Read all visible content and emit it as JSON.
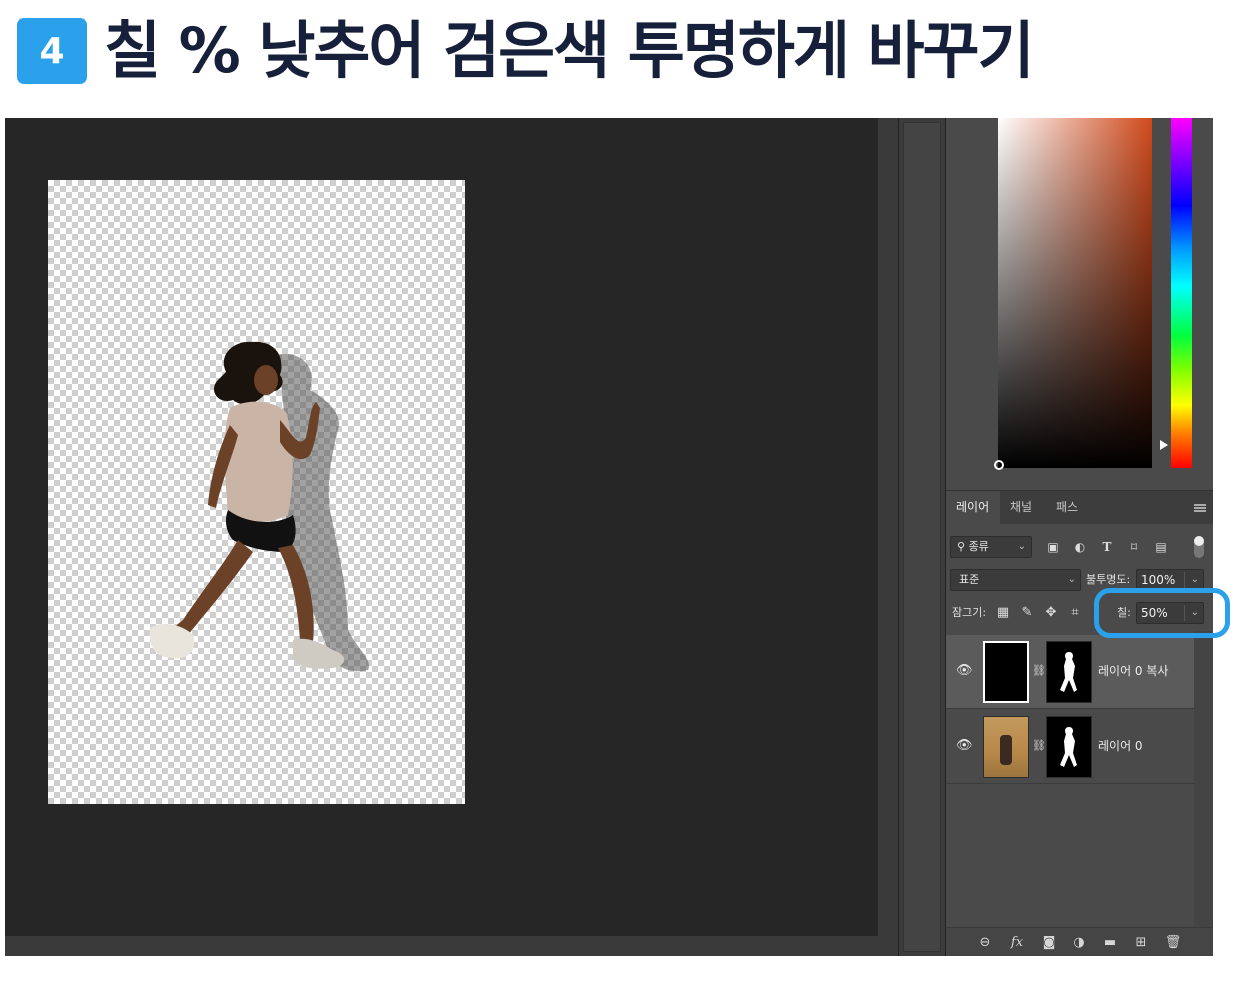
{
  "header": {
    "step_number": "4",
    "title": "칠 % 낮추어 검은색 투명하게 바꾸기"
  },
  "colors": {
    "step_badge": "#2aa1ea",
    "title_text": "#17203a",
    "highlight_ring": "#2aa1ea",
    "workspace": "#262626",
    "panel": "#4a4a4a"
  },
  "layers_panel": {
    "tabs": [
      {
        "label": "레이어"
      },
      {
        "label": "채널"
      },
      {
        "label": "패스"
      }
    ],
    "filter": {
      "label": "종류"
    },
    "blend_mode": "표준",
    "opacity_label": "불투명도:",
    "opacity_value": "100%",
    "lock_label": "잠그기:",
    "fill_label": "칠:",
    "fill_value": "50%",
    "layers": [
      {
        "name": "레이어 0 복사",
        "selected": true
      },
      {
        "name": "레이어 0",
        "selected": false
      }
    ],
    "filter_icons": [
      "image-filter-icon",
      "adjustment-filter-icon",
      "type-filter-icon",
      "shape-filter-icon",
      "smart-object-filter-icon",
      "filter-toggle-icon"
    ],
    "lock_icons": [
      "lock-transparent-pixels-icon",
      "lock-image-pixels-icon",
      "lock-position-icon",
      "lock-artboard-icon"
    ],
    "bottom_icons": [
      "link-layers-icon",
      "fx-icon",
      "add-mask-icon",
      "adjustment-layer-icon",
      "group-folder-icon",
      "new-layer-icon",
      "trash-icon"
    ]
  }
}
